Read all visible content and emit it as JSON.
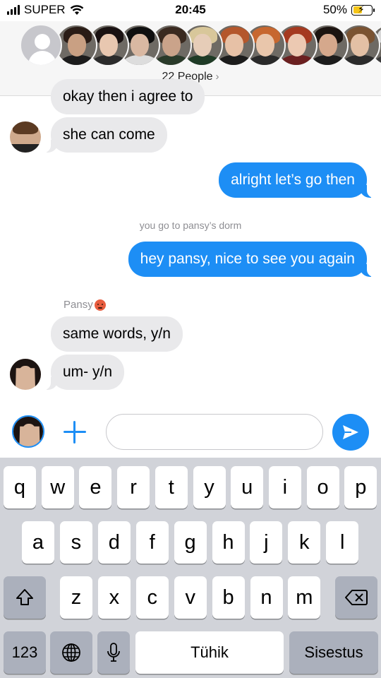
{
  "status_bar": {
    "carrier": "SUPER",
    "time": "20:45",
    "battery_percent": "50%",
    "battery_level": 0.5,
    "charging": true
  },
  "header": {
    "participants_label": "22 People",
    "chevron": "›",
    "avatars": [
      {
        "name": "placeholder-avatar",
        "skin": "#ffffff",
        "hair": "#c7c7cc",
        "robe": "#c7c7cc"
      },
      {
        "name": "participant-1",
        "skin": "#c9a083",
        "hair": "#2a1c16",
        "robe": "#1c1c1c"
      },
      {
        "name": "participant-2",
        "skin": "#e8c7b0",
        "hair": "#1a1212",
        "robe": "#2b2b2b"
      },
      {
        "name": "participant-3",
        "skin": "#d9b8a2",
        "hair": "#0f0f0f",
        "robe": "#dddddd"
      },
      {
        "name": "participant-4",
        "skin": "#caa38a",
        "hair": "#3a2a20",
        "robe": "#2a3a2a"
      },
      {
        "name": "participant-5",
        "skin": "#e6cdb8",
        "hair": "#d8c79a",
        "robe": "#1f3b26"
      },
      {
        "name": "participant-6",
        "skin": "#e7c1a6",
        "hair": "#b4572c",
        "robe": "#1c1c1c"
      },
      {
        "name": "participant-7",
        "skin": "#e9c6ab",
        "hair": "#c7672f",
        "robe": "#2a2a2a"
      },
      {
        "name": "participant-8",
        "skin": "#ecc9b2",
        "hair": "#a53a20",
        "robe": "#6b2020"
      },
      {
        "name": "participant-9",
        "skin": "#d5a88c",
        "hair": "#1c1410",
        "robe": "#1c1c1c"
      },
      {
        "name": "participant-10",
        "skin": "#e3c0a5",
        "hair": "#7a5332",
        "robe": "#2b2b2b"
      },
      {
        "name": "participant-11",
        "skin": "#e0c4b4",
        "hair": "#d8d8d8",
        "robe": "#3a3a3a"
      }
    ]
  },
  "messages": {
    "m1": "okay then i agree to",
    "m2": "she can come",
    "m3": "alright let’s go then",
    "note": "you go to pansy’s dorm",
    "m4": "hey pansy, nice to see you again",
    "sender_name": "Pansy",
    "m5": "same words, y/n",
    "m6": "um- y/n"
  },
  "colors": {
    "accent": "#1d8ef5",
    "received_bubble": "#e9e9eb",
    "keyboard_bg": "#d1d3d9"
  },
  "composer": {
    "placeholder": "",
    "value": ""
  },
  "keyboard": {
    "row1": [
      "q",
      "w",
      "e",
      "r",
      "t",
      "y",
      "u",
      "i",
      "o",
      "p"
    ],
    "row2": [
      "a",
      "s",
      "d",
      "f",
      "g",
      "h",
      "j",
      "k",
      "l"
    ],
    "row3": [
      "z",
      "x",
      "c",
      "v",
      "b",
      "n",
      "m"
    ],
    "numbers_key": "123",
    "space_key": "Tühik",
    "return_key": "Sisestus",
    "shift_icon": "shift-icon",
    "delete_icon": "delete-icon",
    "globe_icon": "globe-icon",
    "mic_icon": "microphone-icon"
  }
}
